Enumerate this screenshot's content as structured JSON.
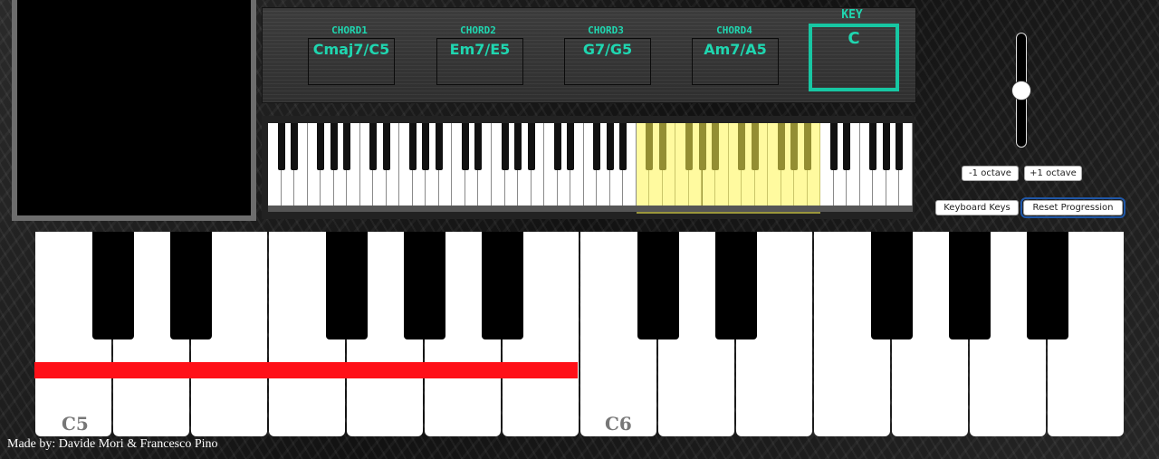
{
  "chords": [
    {
      "label": "CHORD1",
      "name": "Cmaj7/C5"
    },
    {
      "label": "CHORD2",
      "name": "Em7/E5"
    },
    {
      "label": "CHORD3",
      "name": "G7/G5"
    },
    {
      "label": "CHORD4",
      "name": "Am7/A5"
    }
  ],
  "key": {
    "label": "KEY",
    "value": "C"
  },
  "octave_controls": {
    "down_label": "-1 octave",
    "up_label": "+1 octave"
  },
  "buttons": {
    "keyboard_keys": "Keyboard Keys",
    "reset_progression": "Reset Progression"
  },
  "volume_slider": {
    "level_fraction": 0.5
  },
  "keyboard": {
    "octave_labels": [
      "C5",
      "C6"
    ]
  },
  "credits": "Made by: Davide Mori & Francesco Pino",
  "colors": {
    "accent": "#1fd6b0",
    "highlight": "#ff1018",
    "range_highlight": "#fff350"
  }
}
